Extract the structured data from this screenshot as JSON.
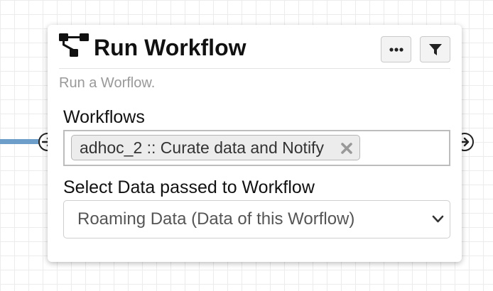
{
  "node": {
    "title": "Run Workflow",
    "description": "Run a Worflow.",
    "icons": {
      "title": "workflow-tree-icon",
      "more": "ellipsis-icon",
      "filter": "filter-icon",
      "input_port": "arrow-circle-right-icon",
      "output_port": "arrow-circle-right-icon",
      "remove_tag": "close-icon",
      "dropdown": "chevron-down-icon"
    }
  },
  "fields": {
    "workflows": {
      "label": "Workflows",
      "selected": [
        "adhoc_2 :: Curate data and Notify"
      ]
    },
    "data_passed": {
      "label": "Select Data passed to Workflow",
      "selected": "Roaming Data (Data of this Worflow)"
    }
  },
  "colors": {
    "connector": "#6d9ec9",
    "canvas_grid": "#ececec"
  }
}
